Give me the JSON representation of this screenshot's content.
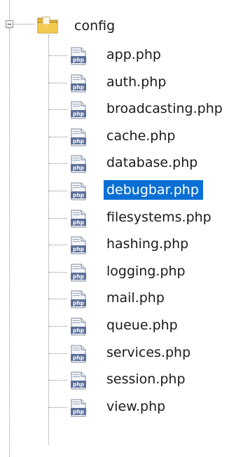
{
  "tree": {
    "folder": {
      "name": "config",
      "icon": "folder-icon",
      "expanded": true
    },
    "files": [
      {
        "name": "app.php",
        "icon": "php-file-icon",
        "selected": false
      },
      {
        "name": "auth.php",
        "icon": "php-file-icon",
        "selected": false
      },
      {
        "name": "broadcasting.php",
        "icon": "php-file-icon",
        "selected": false
      },
      {
        "name": "cache.php",
        "icon": "php-file-icon",
        "selected": false
      },
      {
        "name": "database.php",
        "icon": "php-file-icon",
        "selected": false
      },
      {
        "name": "debugbar.php",
        "icon": "php-file-icon",
        "selected": true
      },
      {
        "name": "filesystems.php",
        "icon": "php-file-icon",
        "selected": false
      },
      {
        "name": "hashing.php",
        "icon": "php-file-icon",
        "selected": false
      },
      {
        "name": "logging.php",
        "icon": "php-file-icon",
        "selected": false
      },
      {
        "name": "mail.php",
        "icon": "php-file-icon",
        "selected": false
      },
      {
        "name": "queue.php",
        "icon": "php-file-icon",
        "selected": false
      },
      {
        "name": "services.php",
        "icon": "php-file-icon",
        "selected": false
      },
      {
        "name": "session.php",
        "icon": "php-file-icon",
        "selected": false
      },
      {
        "name": "view.php",
        "icon": "php-file-icon",
        "selected": false
      }
    ],
    "colors": {
      "selection": "#0a6fd4",
      "text": "#1a1a1a",
      "tree_line": "#8a8a8a"
    }
  }
}
